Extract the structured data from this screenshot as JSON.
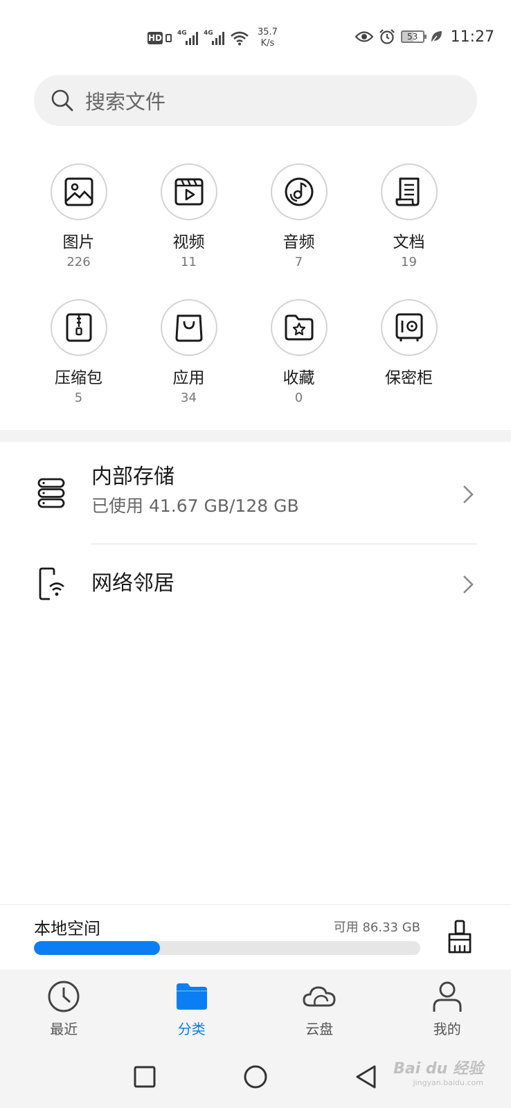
{
  "status_bar": {
    "hd": "HD",
    "net1": "4G",
    "net2": "4G",
    "speed_value": "35.7",
    "speed_unit": "K/s",
    "battery": "53",
    "time": "11:27"
  },
  "search": {
    "placeholder": "搜索文件"
  },
  "categories": [
    {
      "label": "图片",
      "count": "226",
      "icon": "image-icon"
    },
    {
      "label": "视频",
      "count": "11",
      "icon": "video-icon"
    },
    {
      "label": "音频",
      "count": "7",
      "icon": "audio-icon"
    },
    {
      "label": "文档",
      "count": "19",
      "icon": "document-icon"
    },
    {
      "label": "压缩包",
      "count": "5",
      "icon": "archive-icon"
    },
    {
      "label": "应用",
      "count": "34",
      "icon": "app-bag-icon"
    },
    {
      "label": "收藏",
      "count": "0",
      "icon": "favorites-folder-icon"
    },
    {
      "label": "保密柜",
      "count": "",
      "icon": "safe-icon"
    }
  ],
  "storage": {
    "internal_title": "内部存储",
    "internal_usage": "已使用 41.67 GB/128 GB",
    "network_title": "网络邻居"
  },
  "local_space": {
    "title": "本地空间",
    "free": "可用 86.33 GB",
    "used_fraction": 0.326
  },
  "bottom_nav": [
    {
      "label": "最近",
      "icon": "clock-icon"
    },
    {
      "label": "分类",
      "icon": "folder-icon",
      "active": true
    },
    {
      "label": "云盘",
      "icon": "cloud-icon"
    },
    {
      "label": "我的",
      "icon": "person-icon"
    }
  ],
  "colors": {
    "accent": "#0a7ef2",
    "progress_track": "#e6e6e6"
  },
  "watermark": {
    "brand": "Bai du 经验",
    "site": "jingyan.baidu.com"
  }
}
